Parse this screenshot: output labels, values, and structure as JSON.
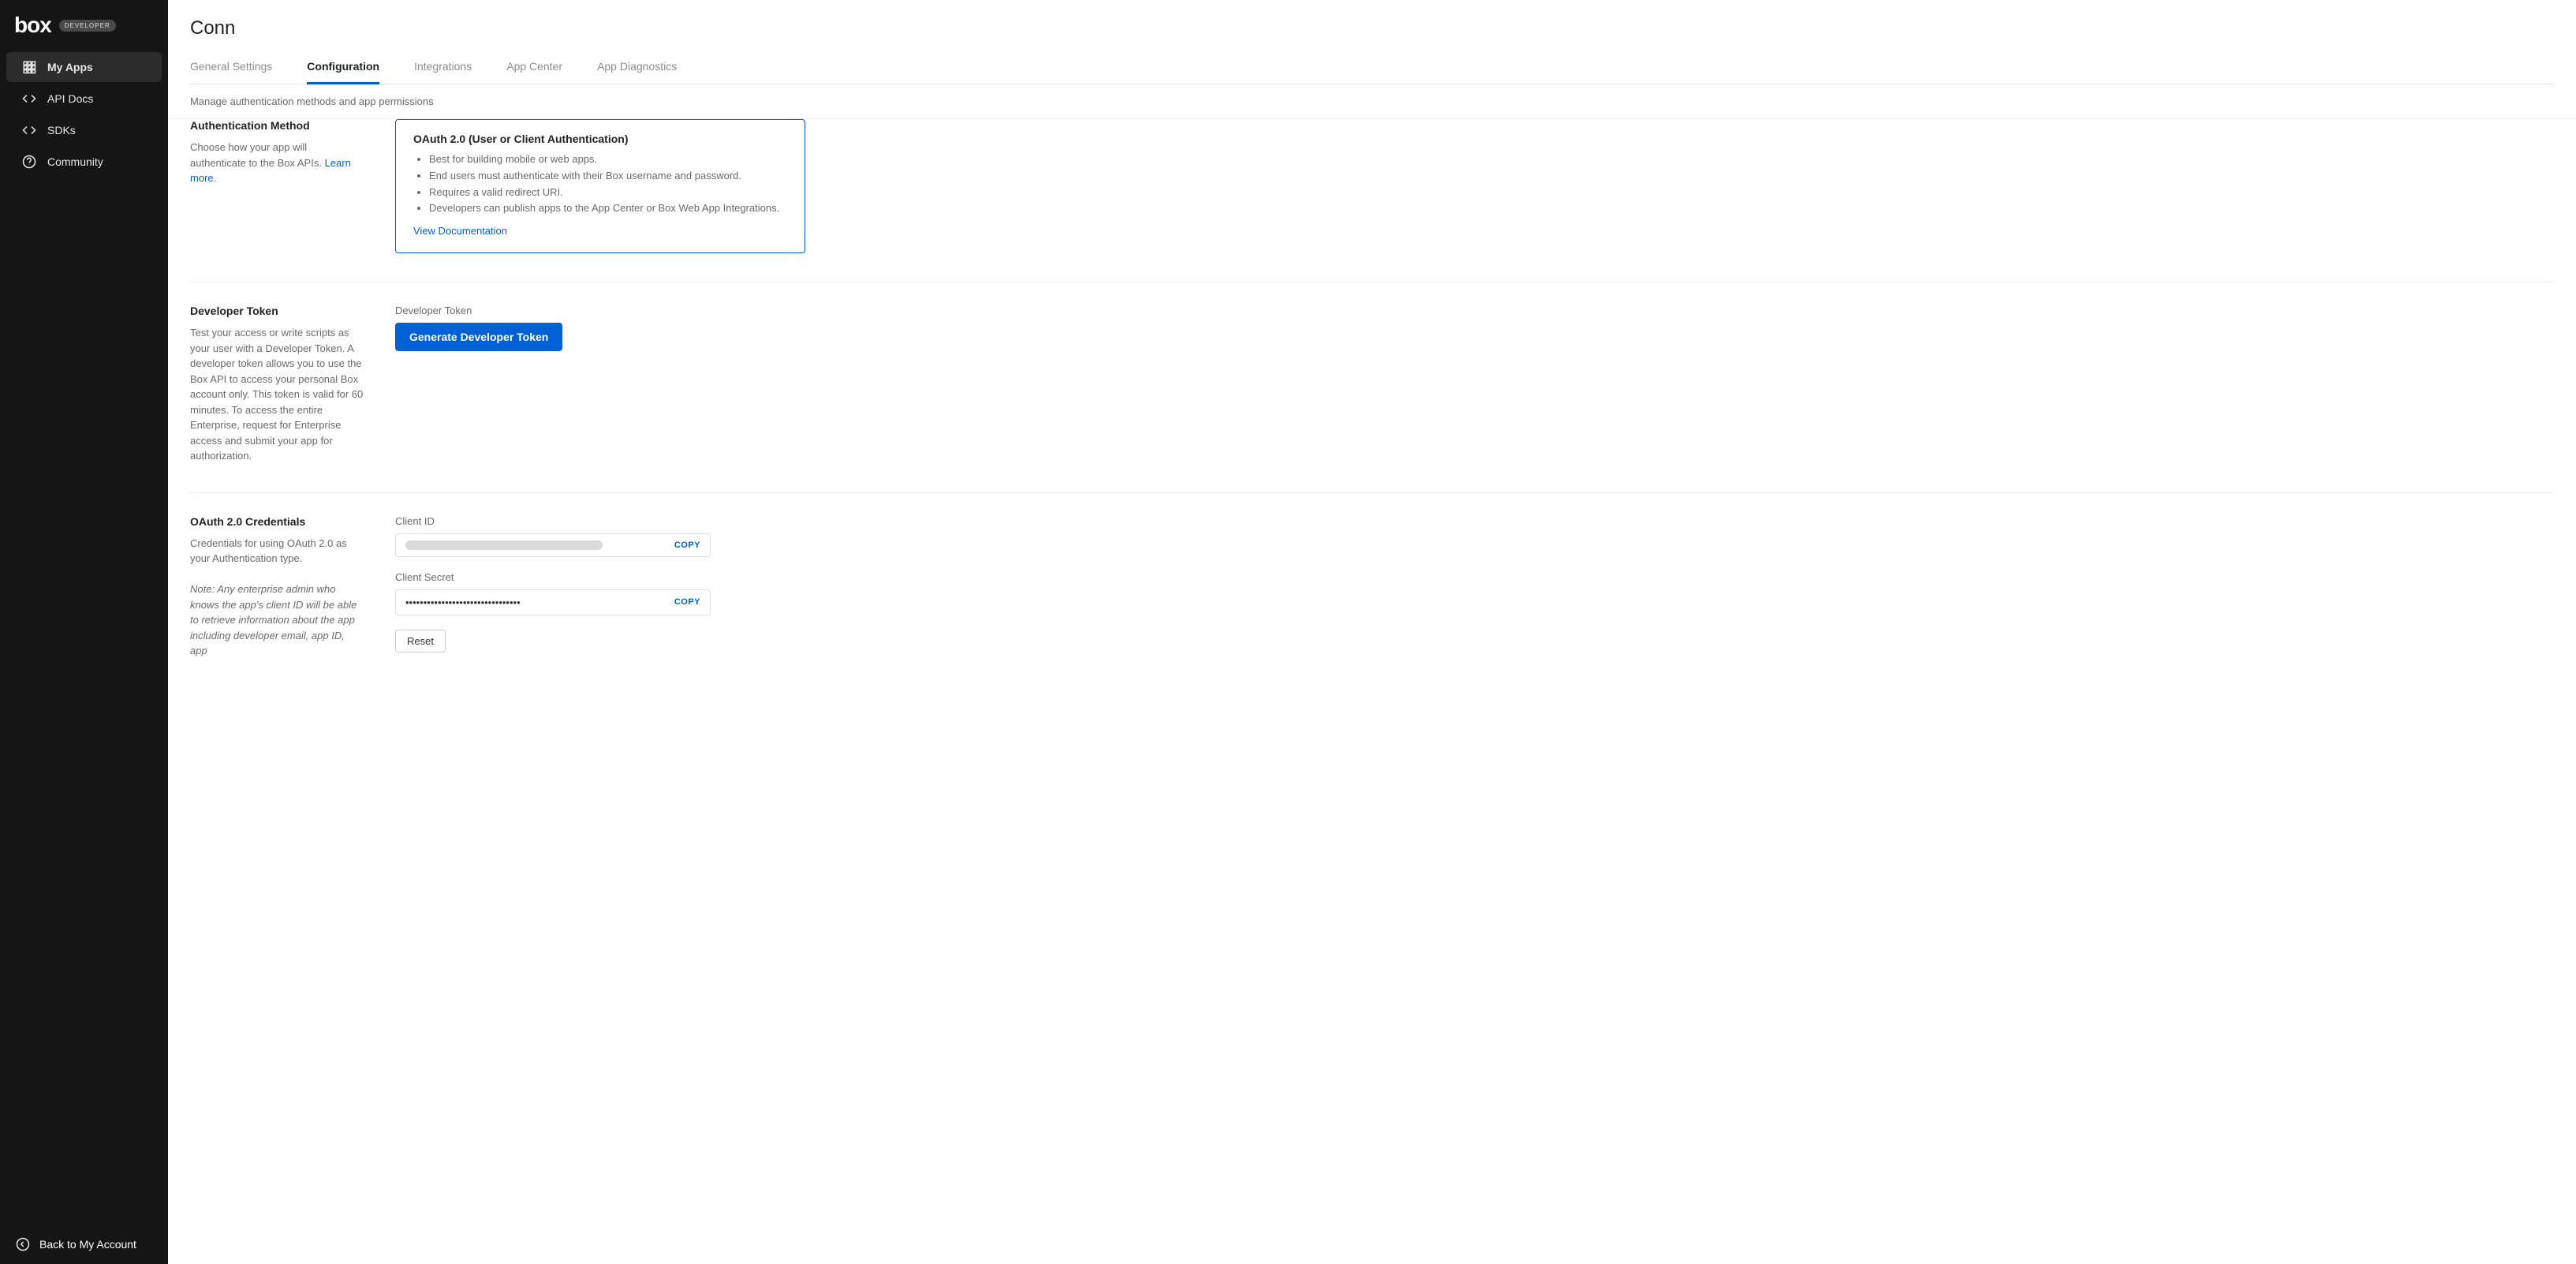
{
  "brand": {
    "name": "box",
    "badge": "DEVELOPER"
  },
  "sidebar": {
    "items": [
      {
        "label": "My Apps"
      },
      {
        "label": "API Docs"
      },
      {
        "label": "SDKs"
      },
      {
        "label": "Community"
      }
    ],
    "footer": "Back to My Account"
  },
  "page": {
    "title": "Conn",
    "tabs": [
      "General Settings",
      "Configuration",
      "Integrations",
      "App Center",
      "App Diagnostics"
    ],
    "subheader": "Manage authentication methods and app permissions"
  },
  "auth": {
    "side_title": "Authentication Method",
    "side_desc": "Choose how your app will authenticate to the Box APIs. ",
    "learn_more": "Learn more.",
    "card_title": "OAuth 2.0 (User or Client Authentication)",
    "bullets": [
      "Best for building mobile or web apps.",
      "End users must authenticate with their Box username and password.",
      "Requires a valid redirect URI.",
      "Developers can publish apps to the App Center or Box Web App Integrations."
    ],
    "doc_link": "View Documentation"
  },
  "token": {
    "side_title": "Developer Token",
    "side_desc": "Test your access or write scripts as your user with a Developer Token. A developer token allows you to use the Box API to access your personal Box account only. This token is valid for 60 minutes. To access the entire Enterprise, request for Enterprise access and submit your app for authorization.",
    "field_label": "Developer Token",
    "button": "Generate Developer Token"
  },
  "creds": {
    "side_title": "OAuth 2.0 Credentials",
    "side_desc": "Credentials for using OAuth 2.0 as your Authentication type.",
    "note": "Note: Any enterprise admin who knows the app's client ID will be able to retrieve information about the app including developer email, app ID, app",
    "client_id_label": "Client ID",
    "client_secret_label": "Client Secret",
    "client_secret_value": "••••••••••••••••••••••••••••••••",
    "copy": "COPY",
    "reset": "Reset"
  }
}
